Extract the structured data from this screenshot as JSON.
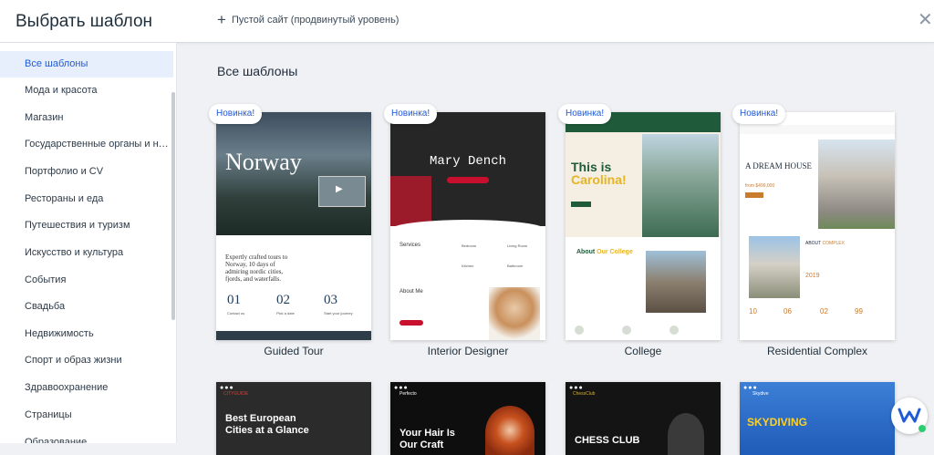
{
  "header": {
    "title": "Выбрать шаблон",
    "blank_site": "Пустой сайт (продвинутый уровень)",
    "close_symbol": "✕"
  },
  "sidebar": {
    "items": [
      {
        "label": "Все шаблоны",
        "active": true
      },
      {
        "label": "Мода и красота"
      },
      {
        "label": "Магазин"
      },
      {
        "label": "Государственные органы и неко..."
      },
      {
        "label": "Портфолио и CV"
      },
      {
        "label": "Рестораны и еда"
      },
      {
        "label": "Путешествия и туризм"
      },
      {
        "label": "Искусство и культура"
      },
      {
        "label": "События"
      },
      {
        "label": "Свадьба"
      },
      {
        "label": "Недвижимость"
      },
      {
        "label": "Спорт и образ жизни"
      },
      {
        "label": "Здравоохранение"
      },
      {
        "label": "Страницы"
      },
      {
        "label": "Образование"
      }
    ]
  },
  "main": {
    "heading": "Все шаблоны",
    "badge": "Новинка!",
    "templates": [
      {
        "name": "Guided Tour",
        "hero_title": "Norway",
        "headline": "Expertly crafted tours to Norway, 10 days of admiring nordic cities, fjords, and waterfalls.",
        "steps": [
          "01",
          "02",
          "03"
        ],
        "step_labels": [
          "Contact us",
          "Pick a date",
          "Start your journey"
        ]
      },
      {
        "name": "Interior Designer",
        "hero_title": "Mary Dench",
        "services_heading": "Services",
        "about_heading": "About Me",
        "services": [
          "Bedroom",
          "Living Room",
          "Kitchen",
          "Bathroom"
        ]
      },
      {
        "name": "College",
        "hero_line1": "This is",
        "hero_line2": "Carolina!",
        "about_heading": "About",
        "about_accent": "Our College"
      },
      {
        "name": "Residential Complex",
        "headline": "A DREAM HOUSE",
        "price": "from $499,000",
        "about_heading": "ABOUT",
        "about_accent": "COMPLEX",
        "year": "2019",
        "stats": [
          "10",
          "06",
          "02",
          "99"
        ]
      }
    ],
    "row2": [
      {
        "headline": "Best European Cities at a Glance",
        "brand": "CITYGUIDE"
      },
      {
        "headline": "Your Hair Is Our Craft",
        "brand": "Perfecto"
      },
      {
        "headline": "CHESS CLUB",
        "brand": "ChessClub"
      },
      {
        "headline": "SKYDIVING",
        "brand": "Skydive"
      }
    ]
  },
  "colors": {
    "accent": "#1f5bd6",
    "college_green": "#1f5b3a",
    "college_yellow": "#e6b422",
    "interior_red": "#c8102e",
    "residential_orange": "#c97b2e",
    "skydiving_yellow": "#ffd21f"
  }
}
